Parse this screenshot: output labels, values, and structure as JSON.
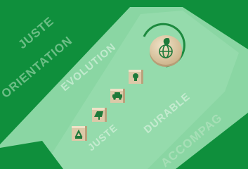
{
  "image": {
    "kind": "photo",
    "words": [
      "JUSTE",
      "ORIENTATION",
      "EVOLUTION",
      "DURABLE",
      "JUSTE",
      "ACCOMPAG"
    ],
    "icons": [
      "globe-leaf-icon",
      "lightbulb-icon",
      "electric-car-icon",
      "solar-panel-icon",
      "recycle-icon"
    ],
    "colors": {
      "dark_green": "#0f8f3c",
      "mint": "#8ad6a3",
      "block_wood": "#dcc9a8",
      "icon_green": "#1e7a3a"
    }
  }
}
